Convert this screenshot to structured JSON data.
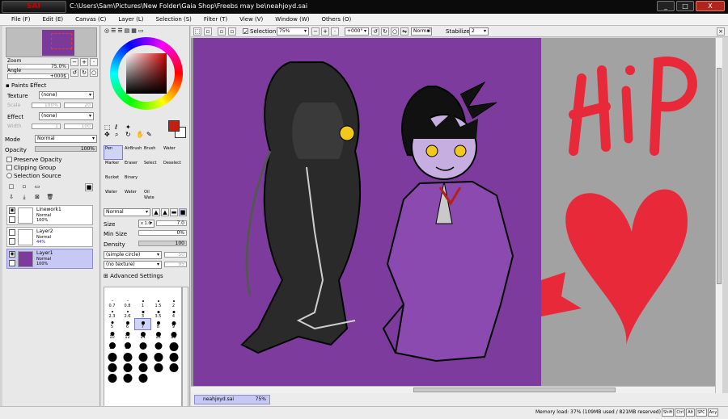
{
  "titlebar": {
    "logo_text": "SAI",
    "title": "C:\\Users\\Sam\\Pictures\\New Folder\\Gaia Shop\\Freebs may be\\neahjoyd.sai",
    "minimize": "_",
    "maximize": "□",
    "close": "X"
  },
  "menu": [
    "File (F)",
    "Edit (E)",
    "Canvas (C)",
    "Layer (L)",
    "Selection (S)",
    "Filter (T)",
    "View (V)",
    "Window (W)",
    "Others (O)"
  ],
  "navigator": {
    "zoom_label": "Zoom",
    "zoom_value": "75.0%",
    "angle_label": "Angle",
    "angle_value": "+000$"
  },
  "paints_effect": {
    "header": "Paints Effect",
    "texture_label": "Texture",
    "texture_value": "(none)",
    "scale_label": "Scale",
    "scale_value": "100%",
    "scale_num": "20",
    "effect_label": "Effect",
    "effect_value": "(none)",
    "width_label": "Width",
    "width_value": "1",
    "width_num": "100"
  },
  "layer_props": {
    "mode_label": "Mode",
    "mode_value": "Normal",
    "opacity_label": "Opacity",
    "opacity_value": "100%",
    "preserve_opacity": "Preserve Opacity",
    "clipping_group": "Clipping Group",
    "selection_source": "Selection Source"
  },
  "layers": [
    {
      "name": "Linework1",
      "mode": "Normal",
      "opacity": "100%"
    },
    {
      "name": "Layer2",
      "mode": "Normal",
      "opacity": "44%"
    },
    {
      "name": "Layer1",
      "mode": "Normal",
      "opacity": "100%"
    }
  ],
  "tools": [
    "Pen",
    "AirBrush",
    "Brush",
    "Water",
    "Marker",
    "Eraser",
    "Select",
    "Deselect",
    "Bucket",
    "Binary",
    "",
    ""
  ],
  "tools_row4": [
    "Water",
    "Water",
    "Oil Wate",
    ""
  ],
  "brush": {
    "mode_value": "Normal",
    "size_label": "Size",
    "size_mult": "x 1.0",
    "size_value": "7.0",
    "minsize_label": "Min Size",
    "minsize_value": "0%",
    "density_label": "Density",
    "density_value": "100",
    "shape_value": "(simple circle)",
    "shape_num": "50",
    "texture_value": "(no texture)",
    "texture_num": "95",
    "advanced_label": "Advanced Settings"
  },
  "brush_sizes": [
    "",
    "",
    "",
    "",
    "",
    "0.7",
    "0.8",
    "1",
    "1.5",
    "2",
    "2.3",
    "2.6",
    "3",
    "3.5",
    "4",
    "5",
    "6",
    "7",
    "8",
    "9",
    "10",
    "12",
    "14",
    "16",
    "20",
    "25",
    "30",
    "35",
    "40",
    "50",
    "60",
    "70",
    "80",
    "100",
    "120",
    "160",
    "200",
    "250",
    "300",
    "350",
    "400",
    "450",
    "500",
    "",
    ""
  ],
  "toolbar2": {
    "selection_label": "Selection",
    "zoom_value": "75%",
    "angle_value": "+000°",
    "mode_value": "Normal",
    "stabilizer_label": "Stabilizer",
    "stabilizer_value": "2"
  },
  "tab": {
    "filename": "neahjoyd.sai",
    "zoom": "75%"
  },
  "status": {
    "memory": "Memory load: 37% (109MB used / 821MB reserved)",
    "keys": [
      "Shift",
      "Ctrl",
      "Alt",
      "SPC",
      "Any"
    ]
  },
  "colors": {
    "canvas_bg": "#7e3b9e",
    "main_color": "#c41f10",
    "accent_red": "#e8293a",
    "active_layer": "#c8c8f4"
  }
}
